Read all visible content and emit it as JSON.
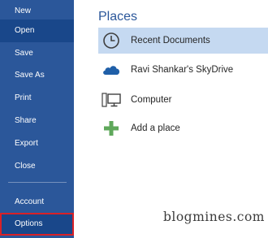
{
  "nav": {
    "items": [
      {
        "label": "New"
      },
      {
        "label": "Open"
      },
      {
        "label": "Save"
      },
      {
        "label": "Save As"
      },
      {
        "label": "Print"
      },
      {
        "label": "Share"
      },
      {
        "label": "Export"
      },
      {
        "label": "Close"
      },
      {
        "label": "Account"
      },
      {
        "label": "Options"
      }
    ],
    "selected": "Open",
    "highlighted": "Options"
  },
  "places": {
    "title": "Places",
    "items": [
      {
        "label": "Recent Documents",
        "icon": "clock-icon",
        "selected": true
      },
      {
        "label": "Ravi Shankar's SkyDrive",
        "icon": "cloud-icon"
      },
      {
        "label": "Computer",
        "icon": "computer-icon"
      },
      {
        "label": "Add a place",
        "icon": "plus-icon"
      }
    ]
  },
  "watermark": "blogmines.com",
  "colors": {
    "nav_background": "#2b579a",
    "nav_selected": "#19478a",
    "highlight_border": "#d92127",
    "place_selected": "#c5d9f1",
    "heading": "#2b579a",
    "skydrive_blue": "#1f5fa8",
    "add_green": "#5fa85b"
  }
}
